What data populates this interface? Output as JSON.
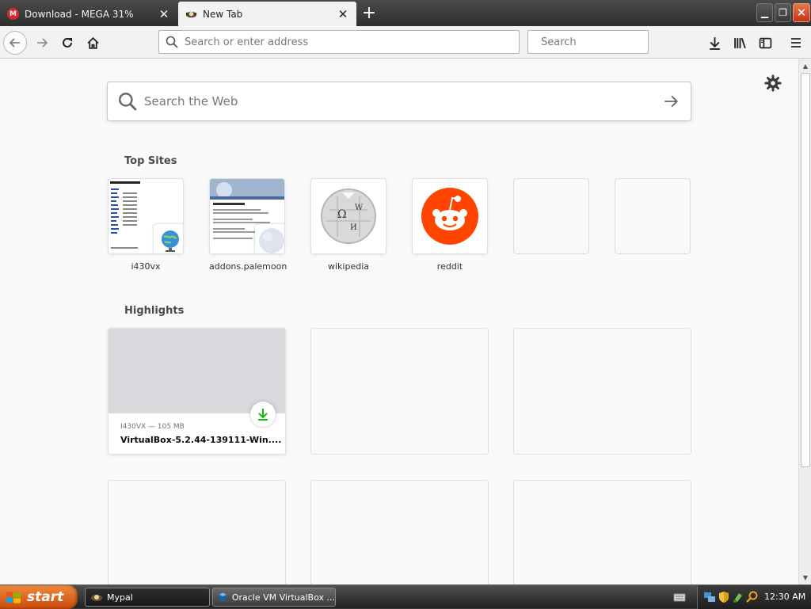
{
  "tabs": [
    {
      "title": "Download - MEGA 31%",
      "active": false,
      "icon": "mega-icon"
    },
    {
      "title": "New Tab",
      "active": true,
      "icon": "palemoon-icon"
    }
  ],
  "navbar": {
    "address_placeholder": "Search or enter address",
    "search_placeholder": "Search"
  },
  "newtab": {
    "search_placeholder": "Search the Web",
    "top_sites_title": "Top Sites",
    "top_sites": [
      {
        "label": "i430vx",
        "icon": "globe-icon"
      },
      {
        "label": "addons.palemoon",
        "icon": "moon-icon"
      },
      {
        "label": "wikipedia",
        "icon": "wikipedia-icon"
      },
      {
        "label": "reddit",
        "icon": "reddit-icon"
      },
      {
        "label": "",
        "icon": ""
      },
      {
        "label": "",
        "icon": ""
      }
    ],
    "highlights_title": "Highlights",
    "highlights": [
      {
        "meta": "I430VX — 105 MB",
        "title": "VirtualBox-5.2.44-139111-Win....",
        "icon": "download-icon"
      }
    ]
  },
  "taskbar": {
    "start_label": "start",
    "items": [
      {
        "label": "Mypal",
        "active": true
      },
      {
        "label": "Oracle VM VirtualBox ...",
        "active": false
      }
    ],
    "clock": "12:30 AM"
  },
  "colors": {
    "download_green": "#12bc00",
    "reddit_orange": "#ff4500",
    "start_orange": "#e36b1c"
  }
}
